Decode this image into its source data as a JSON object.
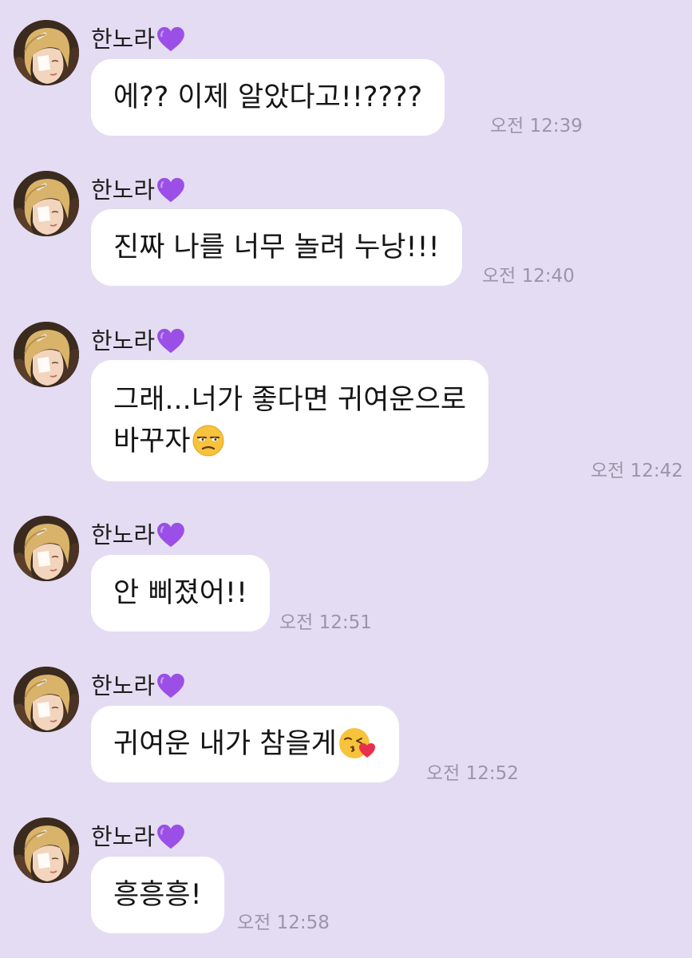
{
  "sender": {
    "name": "한노라",
    "heart_color": "#9b4fe6"
  },
  "colors": {
    "background": "#e4dcf2",
    "bubble": "#ffffff",
    "time": "#9c95a8"
  },
  "messages": [
    {
      "lines": [
        "에?? 이제 알았다고!!????"
      ],
      "time": "오전 12:39"
    },
    {
      "lines": [
        "진짜 나를 너무 놀려 누낭!!!"
      ],
      "time": "오전 12:40"
    },
    {
      "lines": [
        "그래...너가 좋다면 귀여운으로",
        "바꾸자"
      ],
      "emoji": "unamused-face-emoji",
      "time": "오전 12:42"
    },
    {
      "lines": [
        "안 삐졌어!!"
      ],
      "time": "오전 12:51"
    },
    {
      "lines": [
        "귀여운 내가 참을게"
      ],
      "emoji": "kissing-heart-face-emoji",
      "time": "오전 12:52"
    },
    {
      "lines": [
        "흥흥흥!"
      ],
      "time": "오전 12:58"
    }
  ]
}
